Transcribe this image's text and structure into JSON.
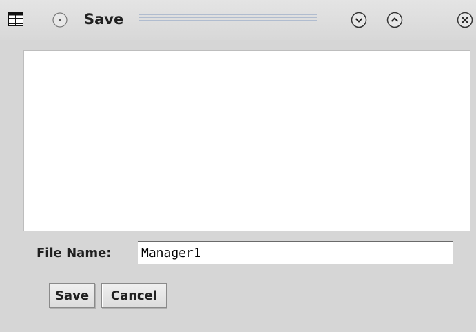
{
  "window": {
    "title": "Save",
    "icons": {
      "menu": "window-menu-icon",
      "shade": "shade-icon",
      "minimize": "minimize-icon",
      "maximize": "maximize-icon",
      "close": "close-icon"
    }
  },
  "form": {
    "file_name_label": "File Name:",
    "file_name_value": "Manager1"
  },
  "buttons": {
    "save_label": "Save",
    "cancel_label": "Cancel"
  },
  "colors": {
    "background": "#d6d6d6",
    "panel": "#ffffff",
    "border": "#7a7a7a"
  }
}
